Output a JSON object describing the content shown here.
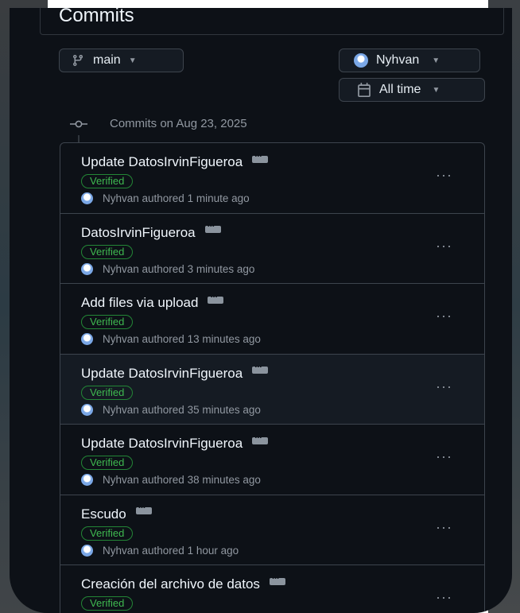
{
  "page": {
    "title": "Commits"
  },
  "filters": {
    "branch": "main",
    "author": "Nyhvan",
    "time": "All time"
  },
  "timeline": {
    "date_label": "Commits on Aug 23, 2025"
  },
  "commits": [
    {
      "message": "Update DatosIrvinFigueroa",
      "badge": "Verified",
      "byline": "Nyhvan authored 1 minute ago"
    },
    {
      "message": "DatosIrvinFigueroa",
      "badge": "Verified",
      "byline": "Nyhvan authored 3 minutes ago"
    },
    {
      "message": "Add files via upload",
      "badge": "Verified",
      "byline": "Nyhvan authored 13 minutes ago"
    },
    {
      "message": "Update DatosIrvinFigueroa",
      "badge": "Verified",
      "byline": "Nyhvan authored 35 minutes ago"
    },
    {
      "message": "Update DatosIrvinFigueroa",
      "badge": "Verified",
      "byline": "Nyhvan authored 38 minutes ago"
    },
    {
      "message": "Escudo",
      "badge": "Verified",
      "byline": "Nyhvan authored 1 hour ago"
    },
    {
      "message": "Creación del archivo de datos",
      "badge": "Verified",
      "byline": ""
    }
  ],
  "icons": {
    "branch": "git-branch-icon",
    "author": "avatar",
    "time": "calendar-icon",
    "commit": "git-commit-icon",
    "more": "kebab-horizontal-icon",
    "expand": "ellipsis-expand-icon"
  }
}
